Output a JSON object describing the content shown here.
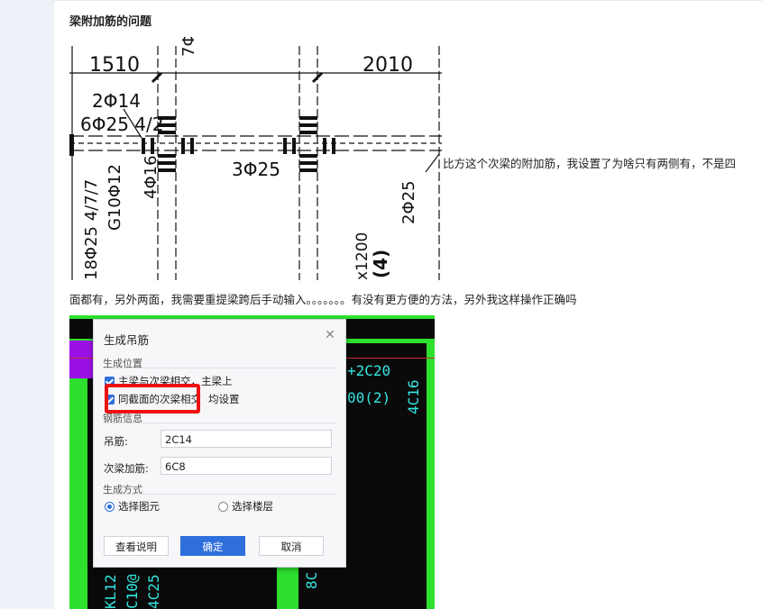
{
  "post": {
    "title": "梁附加筋的问题",
    "inline_text": "比方这个次梁的附加筋，我设置了为啥只有两侧有，不是四",
    "paragraph": "面都有，另外两面，我需要重提梁跨后手动输入。。。。。。。有没有更方便的方法，另外我这样操作正确吗"
  },
  "cad_drawing": {
    "dim_left": "1510",
    "dim_right": "2010",
    "label_2phi14": "2Φ14",
    "label_6phi25": "6Φ25 4/2",
    "label_4phi16": "4Φ16",
    "label_3phi25": "3Φ25",
    "label_g10phi12": "G10Φ12",
    "label_18phi25": "18Φ25 4/7/7",
    "label_2phi25": "2Φ25",
    "label_x1200": "x1200",
    "label_4": "(4)",
    "label_7phi": "7Φ"
  },
  "dialog": {
    "title": "生成吊筋",
    "close_icon": "close-icon",
    "section_position": "生成位置",
    "check1": "主梁与次梁相交，主梁上",
    "check2_a": "同截面的次梁相交",
    "check2_b": "均设置",
    "section_rebar": "钢筋信息",
    "hanging_label": "吊筋:",
    "hanging_value": "2C14",
    "extra_label": "次梁加筋:",
    "extra_value": "6C8",
    "section_method": "生成方式",
    "radio1": "选择图元",
    "radio2": "选择楼层",
    "btn_help": "查看说明",
    "btn_ok": "确定",
    "btn_cancel": "取消"
  },
  "cad_background_text": {
    "t1": "+2C20",
    "t2": "00(2)",
    "t3": "4C16",
    "t4": "KL12",
    "t5": "C10@",
    "t6": "4C25",
    "t7": "8C"
  },
  "colors": {
    "accent": "#2f6fdc",
    "highlight": "#e11111",
    "cad_green": "#2ee02e",
    "cad_cyan": "#33e6e0"
  }
}
